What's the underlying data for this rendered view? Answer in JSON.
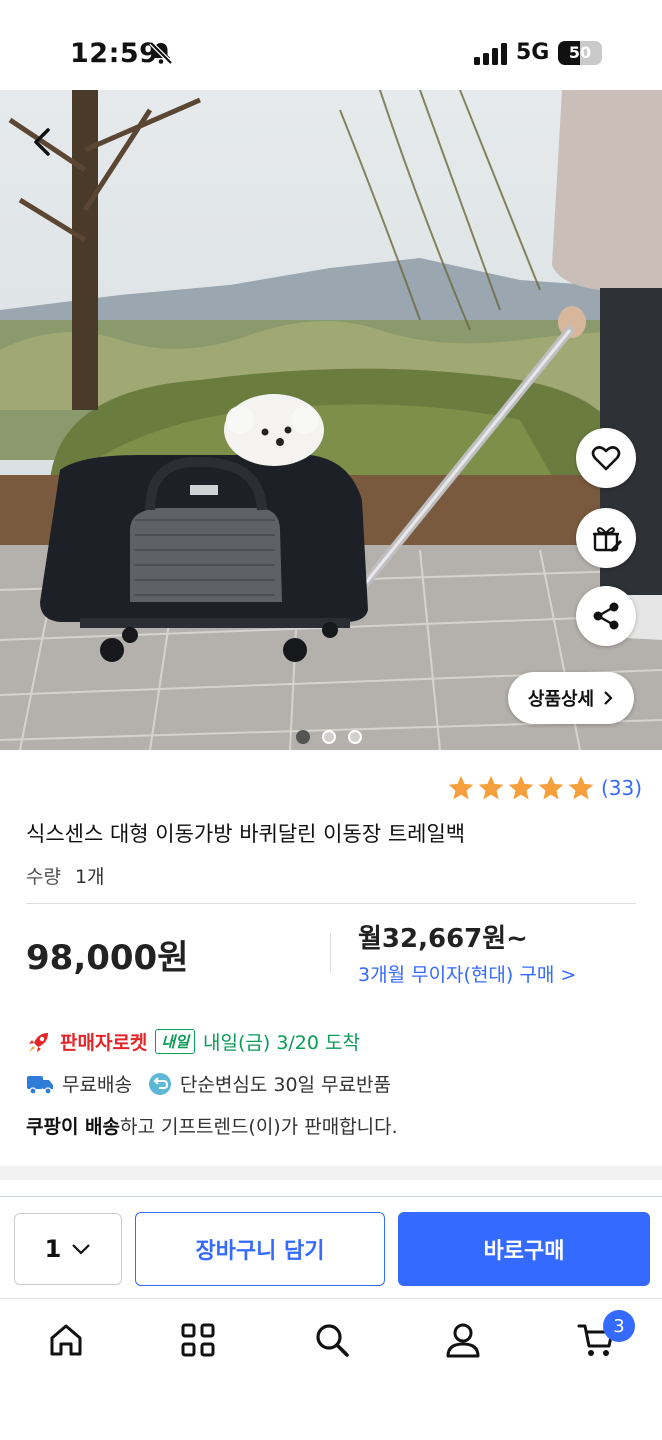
{
  "status_bar": {
    "time": "12:59",
    "network": "5G",
    "battery": "50",
    "battery_level_percent": 50
  },
  "hero": {
    "image_description_icon": "product-photo",
    "pagination": {
      "count": 3,
      "active_index": 0
    },
    "detail_button_label": "상품상세"
  },
  "product": {
    "rating_stars": 5,
    "review_count": "(33)",
    "title": "식스센스 대형 이동가방 바퀴달린 이동장 트레일백",
    "quantity_label": "수량",
    "quantity_value": "1개",
    "price": "98,000원",
    "monthly_price": "월32,667원~",
    "installment_text": "3개월 무이자(현대) 구매 >",
    "rocket_label": "판매자로켓",
    "tomorrow_badge": "내일",
    "arrival_text": "내일(금) 3/20 도착",
    "free_shipping": "무료배송",
    "free_return": "단순변심도 30일 무료반품",
    "seller_bold": "쿠팡이 배송",
    "seller_rest": "하고 기프트렌드(이)가 판매합니다."
  },
  "purchase_bar": {
    "quantity": "1",
    "cart_label": "장바구니 담기",
    "buy_label": "바로구매"
  },
  "tab_bar": {
    "cart_count": "3"
  },
  "colors": {
    "accent": "#346aff",
    "star": "#f5a03c",
    "rocket_red": "#e52528",
    "green": "#0a9b57"
  }
}
